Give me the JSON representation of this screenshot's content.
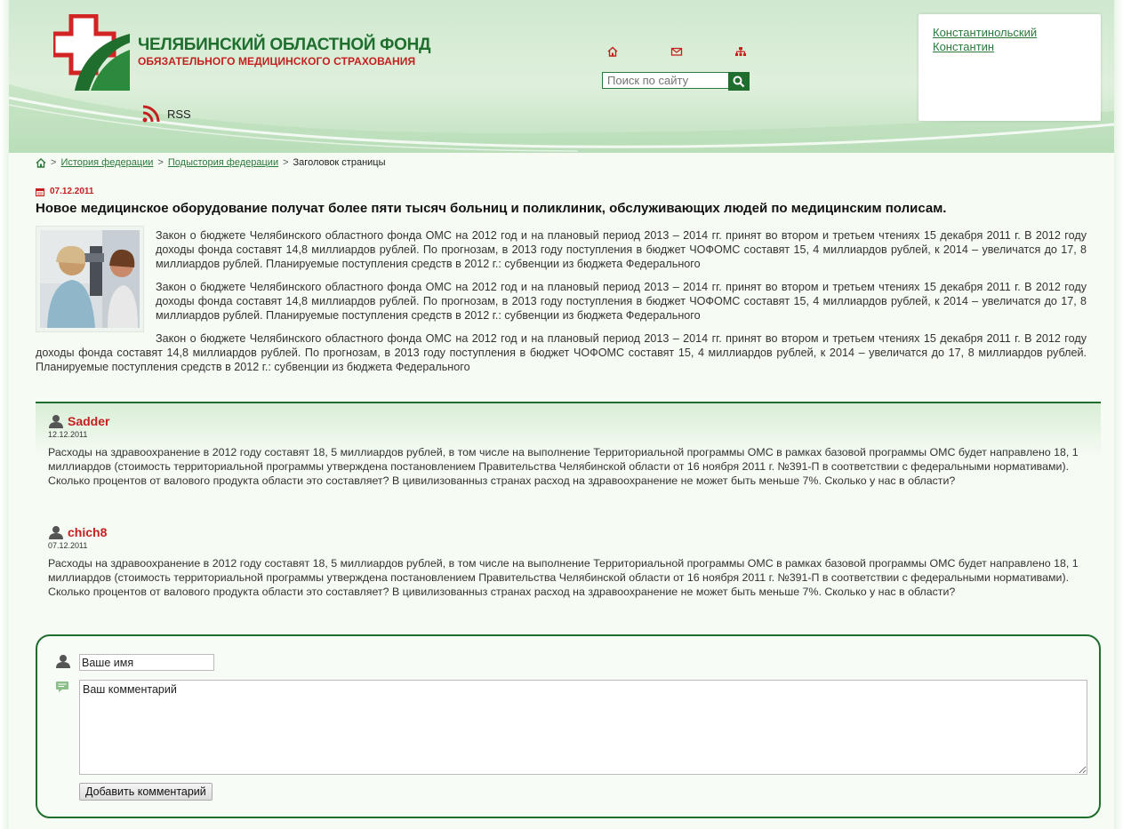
{
  "header": {
    "logo_title": "ЧЕЛЯБИНСКИЙ ОБЛАСТНОЙ ФОНД",
    "logo_subtitle": "ОБЯЗАТЕЛЬНОГО МЕДИЦИНСКОГО СТРАХОВАНИЯ",
    "rss_label": "RSS",
    "icons": [
      "home-icon",
      "mail-icon",
      "sitemap-icon"
    ],
    "search_placeholder": "Поиск по сайту",
    "user_name": "Константинольский Константин"
  },
  "breadcrumb": {
    "items": [
      "История федерации",
      "Подыстория федерации"
    ],
    "current": "Заголовок страницы",
    "separator": ">"
  },
  "article": {
    "date": "07.12.2011",
    "title": "Новое медицинское оборудование получат более пяти тысяч больниц и поликлиник, обслуживающих людей по медицинским полисам.",
    "paragraphs": [
      "Закон о бюджете Челябинского областного фонда ОМС на 2012 год и на плановый период 2013 – 2014 гг. принят во втором и третьем чтениях 15 декабря 2011 г. В 2012 году доходы фонда составят 14,8 миллиардов рублей. По прогнозам, в 2013 году поступления в бюджет ЧОФОМС составят 15, 4 миллиардов рублей, к 2014 – увеличатся до 17, 8 миллиардов рублей. Планируемые поступления средств в 2012 г.: субвенции из бюджета Федерального",
      "Закон о бюджете Челябинского областного фонда ОМС на 2012 год и на плановый период 2013 – 2014 гг. принят во втором и третьем чтениях 15 декабря 2011 г. В 2012 году доходы фонда составят 14,8 миллиардов рублей. По прогнозам, в 2013 году поступления в бюджет ЧОФОМС составят 15, 4 миллиардов рублей, к 2014 – увеличатся до 17, 8 миллиардов рублей. Планируемые поступления средств в 2012 г.: субвенции из бюджета Федерального",
      "Закон о бюджете Челябинского областного фонда ОМС на 2012 год и на плановый период 2013 – 2014 гг. принят во втором и третьем чтениях 15 декабря 2011 г. В 2012 году доходы фонда составят 14,8 миллиардов рублей. По прогнозам, в 2013 году поступления в бюджет ЧОФОМС составят 15, 4 миллиардов рублей, к 2014 – увеличатся до 17, 8 миллиардов рублей. Планируемые поступления средств в 2012 г.: субвенции из бюджета Федерального"
    ]
  },
  "comments": [
    {
      "author": "Sadder",
      "date": "12.12.2011",
      "text": "Расходы на здравоохранение в 2012 году составят 18, 5 миллиардов рублей, в том числе на выполнение Территориальной программы ОМС в рамках базовой программы ОМС будет направлено 18, 1 миллиардов (стоимость территориальной программы утверждена постановлением Правительства Челябинской области от 16 ноября 2011 г. №391-П в соответствии с федеральными нормативами). Сколько процентов от валового продукта области это составляет? В цивилизованныз странах расход на здравоохранение не может быть меньше 7%. Сколько у нас в области?"
    },
    {
      "author": "chich8",
      "date": "07.12.2011",
      "text": "Расходы на здравоохранение в 2012 году составят 18, 5 миллиардов рублей, в том числе на выполнение Территориальной программы ОМС в рамках базовой программы ОМС будет направлено 18, 1 миллиардов (стоимость территориальной программы утверждена постановлением Правительства Челябинской области от 16 ноября 2011 г. №391-П в соответствии с федеральными нормативами). Сколько процентов от валового продукта области это составляет? В цивилизованныз странах расход на здравоохранение не может быть меньше 7%. Сколько у нас в области?"
    }
  ],
  "form": {
    "name_value": "Ваше имя",
    "comment_value": "Ваш комментарий",
    "submit_label": "Добавить комментарий"
  },
  "colors": {
    "brand_green": "#1f6e2e",
    "link_green": "#2a7a3a",
    "accent_red": "#c42020"
  }
}
